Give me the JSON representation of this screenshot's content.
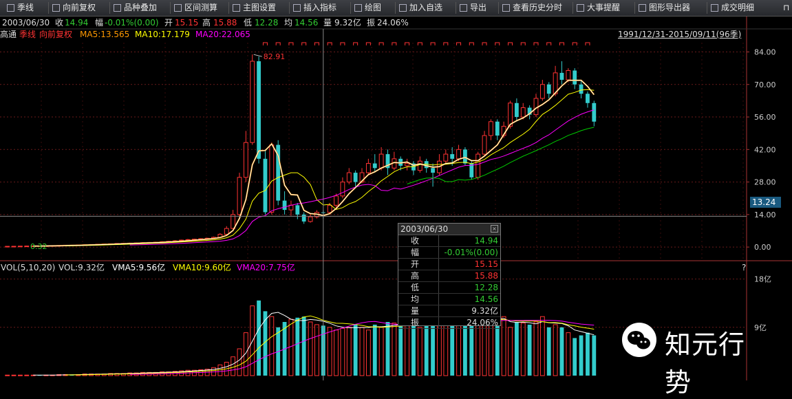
{
  "toolbar": {
    "items": [
      {
        "label": "季线",
        "icon": "bar-chart-icon"
      },
      {
        "label": "向前复权",
        "icon": "cursor-icon"
      },
      {
        "label": "品种叠加",
        "icon": "overlay-icon"
      },
      {
        "label": "区间测算",
        "icon": "range-icon"
      },
      {
        "label": "主图设置",
        "icon": "settings-icon"
      },
      {
        "label": "插入指标",
        "icon": "insert-icon"
      },
      {
        "label": "绘图",
        "icon": "draw-icon"
      },
      {
        "label": "加入自选",
        "icon": "add-icon"
      },
      {
        "label": "导出",
        "icon": "export-icon"
      },
      {
        "label": "查看历史分时",
        "icon": "history-icon"
      },
      {
        "label": "大事提醒",
        "icon": "reminder-icon"
      },
      {
        "label": "图形导出器",
        "icon": "chart-export-icon"
      },
      {
        "label": "成交明细",
        "icon": "detail-icon"
      }
    ]
  },
  "info": {
    "date": "2003/06/30",
    "close_label": "收",
    "close": "14.94",
    "change_label": "幅",
    "change": "-0.01%(0.00)",
    "open_label": "开",
    "open": "15.15",
    "high_label": "高",
    "high": "15.88",
    "low_label": "低",
    "low": "12.28",
    "avg_label": "均",
    "avg": "14.56",
    "vol_label": "量",
    "vol": "9.32亿",
    "amp_label": "振",
    "amp": "24.06%"
  },
  "main_legend": {
    "stock": "高通",
    "period": "季线",
    "adjust": "向前复权",
    "ma5": "MA5:13.565",
    "ma10": "MA10:17.179",
    "ma20": "MA20:22.065",
    "range": "1991/12/31-2015/09/11(96季)"
  },
  "vol_legend": {
    "name": "VOL(5,10,20)",
    "vol": "VOL:9.32亿",
    "vma5": "VMA5:9.56亿",
    "vma10": "VMA10:9.60亿",
    "vma20": "VMA20:7.75亿",
    "help": "?"
  },
  "annotations": {
    "high": "82.91",
    "low": "0.32"
  },
  "price_badge": "13.24",
  "popup": {
    "date": "2003/06/30",
    "rows": [
      {
        "k": "收",
        "v": "14.94",
        "color": "#33cc33"
      },
      {
        "k": "幅",
        "v": "-0.01%(0.00)",
        "color": "#33cc33"
      },
      {
        "k": "开",
        "v": "15.15",
        "color": "#ff3333"
      },
      {
        "k": "高",
        "v": "15.88",
        "color": "#ff3333"
      },
      {
        "k": "低",
        "v": "12.28",
        "color": "#33cc33"
      },
      {
        "k": "均",
        "v": "14.56",
        "color": "#33cc33"
      },
      {
        "k": "量",
        "v": "9.32亿",
        "color": "#dddddd"
      },
      {
        "k": "振",
        "v": "24.06%",
        "color": "#dddddd"
      }
    ]
  },
  "watermark": "知元行势",
  "colors": {
    "up": "#ff3333",
    "down": "#33cccc",
    "ma5": "#ffffff",
    "ma10": "#ffff00",
    "ma20": "#ff00ff",
    "ma60": "#00cc00",
    "thick": "#ff9900"
  },
  "price_axis": {
    "ticks": [
      0,
      14,
      28,
      42,
      56,
      70,
      84
    ],
    "labels": [
      "0.00",
      "14.00",
      "28.00",
      "42.00",
      "56.00",
      "70.00",
      "84.00"
    ]
  },
  "vol_axis": {
    "ticks": [
      9,
      18
    ],
    "labels": [
      "9亿",
      "18亿"
    ]
  },
  "series": {
    "candles": [
      [
        0.3,
        0.32,
        0.28,
        0.33
      ],
      [
        0.32,
        0.34,
        0.31,
        0.35
      ],
      [
        0.34,
        0.4,
        0.33,
        0.42
      ],
      [
        0.4,
        0.45,
        0.38,
        0.48
      ],
      [
        0.45,
        0.5,
        0.43,
        0.55
      ],
      [
        0.5,
        0.48,
        0.45,
        0.56
      ],
      [
        0.48,
        0.52,
        0.46,
        0.55
      ],
      [
        0.52,
        0.6,
        0.5,
        0.65
      ],
      [
        0.6,
        0.7,
        0.58,
        0.75
      ],
      [
        0.7,
        0.8,
        0.68,
        0.85
      ],
      [
        0.8,
        0.78,
        0.72,
        0.9
      ],
      [
        0.78,
        0.9,
        0.76,
        0.95
      ],
      [
        0.9,
        1.0,
        0.85,
        1.1
      ],
      [
        1.0,
        1.1,
        0.95,
        1.2
      ],
      [
        1.1,
        1.2,
        1.05,
        1.3
      ],
      [
        1.2,
        1.3,
        1.1,
        1.4
      ],
      [
        1.3,
        1.4,
        1.25,
        1.5
      ],
      [
        1.4,
        1.55,
        1.35,
        1.7
      ],
      [
        1.55,
        1.6,
        1.45,
        1.8
      ],
      [
        1.6,
        1.7,
        1.5,
        1.9
      ],
      [
        1.7,
        1.8,
        1.6,
        2.0
      ],
      [
        1.8,
        1.9,
        1.7,
        2.1
      ],
      [
        1.9,
        2.0,
        1.8,
        2.2
      ],
      [
        2.0,
        2.1,
        1.9,
        2.3
      ],
      [
        2.1,
        2.3,
        2.0,
        2.5
      ],
      [
        2.3,
        2.5,
        2.2,
        2.7
      ],
      [
        2.5,
        2.7,
        2.4,
        3.0
      ],
      [
        2.7,
        3.0,
        2.6,
        3.2
      ],
      [
        3.0,
        3.2,
        2.9,
        3.5
      ],
      [
        3.2,
        3.4,
        3.0,
        3.6
      ],
      [
        3.4,
        3.6,
        3.2,
        3.8
      ],
      [
        3.6,
        3.8,
        3.4,
        4.0
      ],
      [
        3.8,
        4.2,
        3.7,
        4.5
      ],
      [
        4.2,
        5.5,
        4.0,
        6.0
      ],
      [
        5.5,
        8.0,
        5.2,
        9.0
      ],
      [
        8.0,
        14.0,
        7.5,
        16.0
      ],
      [
        14.0,
        30.0,
        13.0,
        32.0
      ],
      [
        30.0,
        45.0,
        28.0,
        50.0
      ],
      [
        45.0,
        80.0,
        44.0,
        82.91
      ],
      [
        80.0,
        38.0,
        36.0,
        82.0
      ],
      [
        38.0,
        15.0,
        14.0,
        42.0
      ],
      [
        15.0,
        44.0,
        14.0,
        45.0
      ],
      [
        44.0,
        20.0,
        18.0,
        46.0
      ],
      [
        20.0,
        16.0,
        14.0,
        24.0
      ],
      [
        16.0,
        18.0,
        13.5,
        20.0
      ],
      [
        18.0,
        14.0,
        12.0,
        19.0
      ],
      [
        14.0,
        11.0,
        10.0,
        15.0
      ],
      [
        11.0,
        13.0,
        10.5,
        14.0
      ],
      [
        13.0,
        14.95,
        12.28,
        15.88
      ],
      [
        14.95,
        14.94,
        12.28,
        15.88
      ],
      [
        14.94,
        18.0,
        14.0,
        19.0
      ],
      [
        18.0,
        22.0,
        17.0,
        23.0
      ],
      [
        22.0,
        28.0,
        21.0,
        30.0
      ],
      [
        28.0,
        32.0,
        27.0,
        34.0
      ],
      [
        32.0,
        28.0,
        26.0,
        33.0
      ],
      [
        28.0,
        32.0,
        27.5,
        34.0
      ],
      [
        32.0,
        36.0,
        31.0,
        38.0
      ],
      [
        36.0,
        34.0,
        32.0,
        40.0
      ],
      [
        34.0,
        40.0,
        33.0,
        43.0
      ],
      [
        40.0,
        34.0,
        31.0,
        42.0
      ],
      [
        34.0,
        38.0,
        33.0,
        41.0
      ],
      [
        38.0,
        35.0,
        33.0,
        39.0
      ],
      [
        35.0,
        36.0,
        33.0,
        38.0
      ],
      [
        36.0,
        33.0,
        31.0,
        37.0
      ],
      [
        33.0,
        37.0,
        32.0,
        39.0
      ],
      [
        37.0,
        34.0,
        32.0,
        38.0
      ],
      [
        34.0,
        32.0,
        26.0,
        36.0
      ],
      [
        32.0,
        37.0,
        31.0,
        40.0
      ],
      [
        37.0,
        40.0,
        36.0,
        42.0
      ],
      [
        40.0,
        38.0,
        35.0,
        43.0
      ],
      [
        38.0,
        42.0,
        37.0,
        44.0
      ],
      [
        42.0,
        36.0,
        35.0,
        43.0
      ],
      [
        36.0,
        30.0,
        29.0,
        37.0
      ],
      [
        30.0,
        40.0,
        29.0,
        41.0
      ],
      [
        40.0,
        48.0,
        39.0,
        50.0
      ],
      [
        48.0,
        54.0,
        46.0,
        55.0
      ],
      [
        54.0,
        48.0,
        46.0,
        55.0
      ],
      [
        48.0,
        52.0,
        47.0,
        54.0
      ],
      [
        52.0,
        62.0,
        51.0,
        63.0
      ],
      [
        62.0,
        56.0,
        54.0,
        64.0
      ],
      [
        56.0,
        60.0,
        55.0,
        62.0
      ],
      [
        60.0,
        57.0,
        55.0,
        61.0
      ],
      [
        57.0,
        64.0,
        56.0,
        66.0
      ],
      [
        64.0,
        70.0,
        63.0,
        72.0
      ],
      [
        70.0,
        66.0,
        64.0,
        71.0
      ],
      [
        66.0,
        75.0,
        65.0,
        78.0
      ],
      [
        75.0,
        72.0,
        70.0,
        80.0
      ],
      [
        72.0,
        76.0,
        71.0,
        77.0
      ],
      [
        76.0,
        70.0,
        68.0,
        77.0
      ],
      [
        70.0,
        66.0,
        64.0,
        72.0
      ],
      [
        66.0,
        62.0,
        60.0,
        67.0
      ],
      [
        62.0,
        54.0,
        52.0,
        63.0
      ]
    ],
    "volumes": [
      0.1,
      0.1,
      0.1,
      0.1,
      0.1,
      0.1,
      0.1,
      0.1,
      0.2,
      0.2,
      0.2,
      0.2,
      0.3,
      0.3,
      0.3,
      0.3,
      0.4,
      0.4,
      0.4,
      0.5,
      0.5,
      0.6,
      0.6,
      0.6,
      0.7,
      0.7,
      0.8,
      0.9,
      1.0,
      1.0,
      1.1,
      1.2,
      1.5,
      2.0,
      2.5,
      3.5,
      5.0,
      8.0,
      13.0,
      14.0,
      12.0,
      11.0,
      9.0,
      10.0,
      10.5,
      10.8,
      11.0,
      10.0,
      9.5,
      9.32,
      9.0,
      8.5,
      8.8,
      9.0,
      9.5,
      9.0,
      8.5,
      9.5,
      9.0,
      10.0,
      9.8,
      9.2,
      10.0,
      11.0,
      9.0,
      10.5,
      11.0,
      12.0,
      10.5,
      11.0,
      10.0,
      9.5,
      10.0,
      12.0,
      10.8,
      9.5,
      10.0,
      11.0,
      9.0,
      10.0,
      9.8,
      9.5,
      10.0,
      11.0,
      9.0,
      9.5,
      9.0,
      8.0,
      7.0,
      7.5,
      8.0,
      7.5
    ]
  }
}
